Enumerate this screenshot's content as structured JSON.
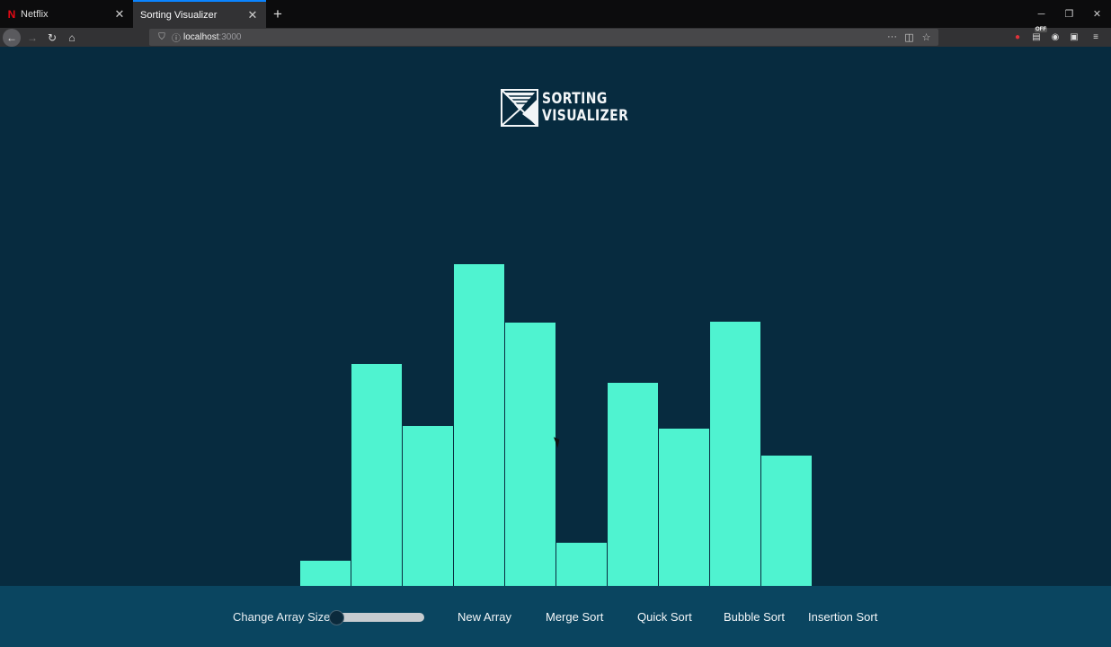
{
  "browser": {
    "tabs": [
      {
        "title": "Netflix",
        "favicon": "N",
        "active": false
      },
      {
        "title": "Sorting Visualizer",
        "active": true
      }
    ],
    "url_host": "localhost",
    "url_port": ":3000",
    "extension_badge": "OFF"
  },
  "app": {
    "logo_line1": "SORTING",
    "logo_line2": "VISUALIZER",
    "bar_color": "#4ff3d0",
    "background_color": "#072b3f",
    "controls": {
      "array_size_label": "Change Array Size:",
      "slider_value_fraction": 0.0,
      "new_array": "New Array",
      "merge_sort": "Merge Sort",
      "quick_sort": "Quick Sort",
      "bubble_sort": "Bubble Sort",
      "insertion_sort": "Insertion Sort"
    }
  },
  "chart_data": {
    "type": "bar",
    "values": [
      28,
      247,
      178,
      358,
      293,
      48,
      226,
      175,
      294,
      145
    ],
    "ylim": [
      0,
      358
    ]
  }
}
